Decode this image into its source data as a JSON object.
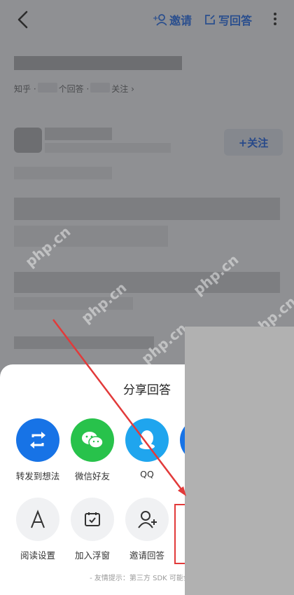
{
  "topbar": {
    "invite_label": "邀请",
    "write_label": "写回答"
  },
  "question": {
    "meta_prefix": "知乎 ·",
    "meta_answers": "个回答 ·",
    "meta_follow": "关注 ›",
    "follow_button": "+关注"
  },
  "share_sheet": {
    "title": "分享回答",
    "row1": [
      {
        "label": "转发到想法",
        "icon": "repost-icon",
        "color": "#1773e6"
      },
      {
        "label": "微信好友",
        "icon": "wechat-icon",
        "color": "#28c24b"
      },
      {
        "label": "QQ",
        "icon": "qq-icon",
        "color": "#1fa5ee"
      }
    ],
    "row2": [
      {
        "label": "阅读设置",
        "icon": "font-a-icon"
      },
      {
        "label": "加入浮窗",
        "icon": "floating-window-icon"
      },
      {
        "label": "邀请回答",
        "icon": "invite-user-icon"
      }
    ],
    "hint": "- 友情提示：第三方 SDK 可能会收集"
  },
  "watermark": "php.cn",
  "colors": {
    "accent": "#1773e6",
    "wechat": "#28c24b",
    "qq": "#1fa5ee",
    "highlight_red": "#e23a3a"
  }
}
